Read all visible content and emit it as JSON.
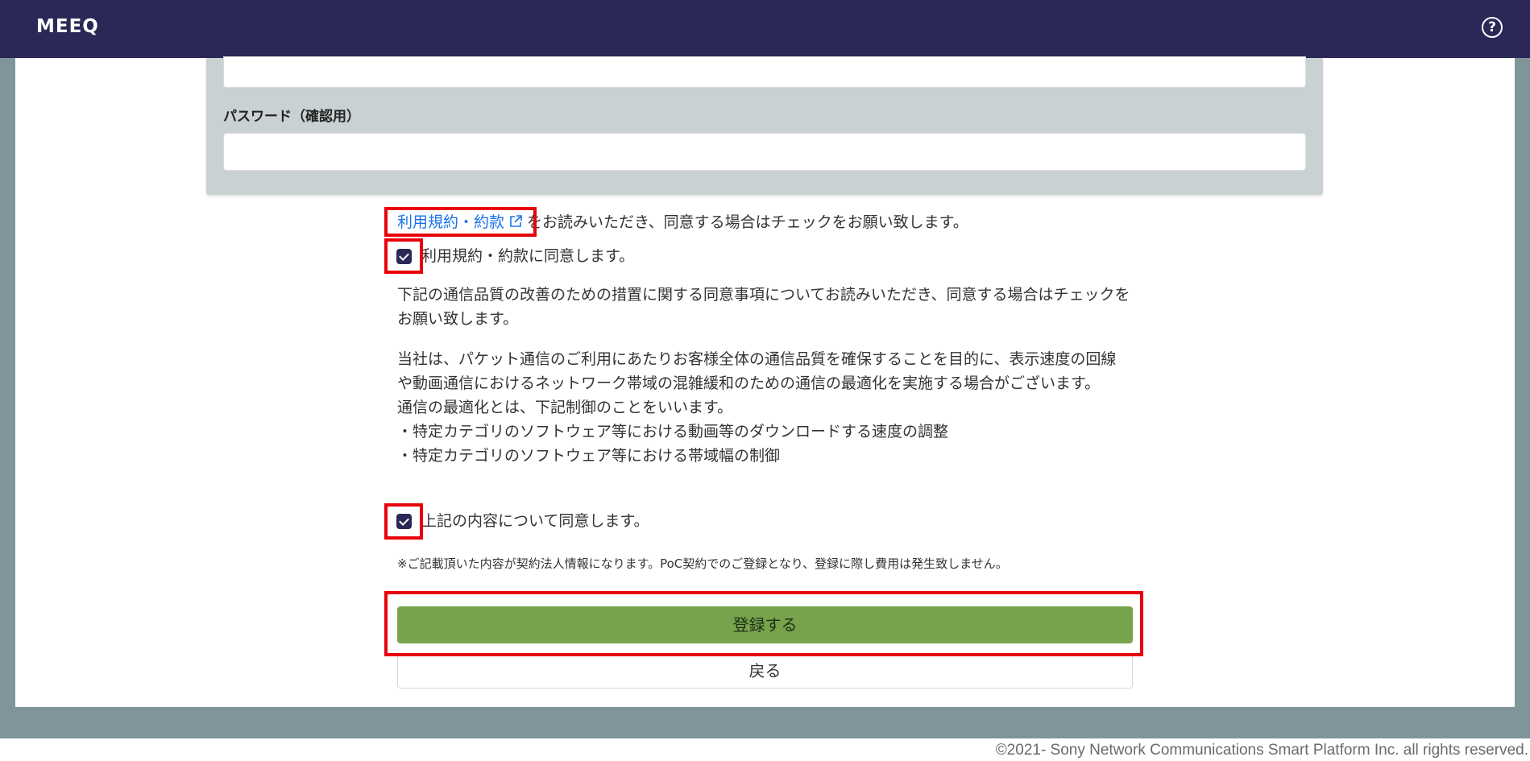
{
  "header": {
    "logo": "MEEQ",
    "help_icon": "question-circle-icon",
    "help_symbol": "?"
  },
  "form": {
    "password_confirm_label": "パスワード（確認用）",
    "password_value": "",
    "password_confirm_value": ""
  },
  "terms": {
    "link_text": "利用規約・約款",
    "link_icon": "external-link-icon",
    "instruction": "をお読みいただき、同意する場合はチェックをお願い致します。",
    "agree_label": "利用規約・約款に同意します。",
    "agree_checked": true
  },
  "quality": {
    "intro": "下記の通信品質の改善のための措置に関する同意事項についてお読みいただき、同意する場合はチェックをお願い致します。",
    "body_line1": "当社は、パケット通信のご利用にあたりお客様全体の通信品質を確保することを目的に、表示速度の回線や動画通信におけるネットワーク帯域の混雑緩和のための通信の最適化を実施する場合がございます。",
    "body_line2": "通信の最適化とは、下記制御のことをいいます。",
    "body_line3": "・特定カテゴリのソフトウェア等における動画等のダウンロードする速度の調整",
    "body_line4": "・特定カテゴリのソフトウェア等における帯域幅の制御",
    "agree_label": "上記の内容について同意します。",
    "agree_checked": true
  },
  "note": "※ご記載頂いた内容が契約法人情報になります。PoC契約でのご登録となり、登録に際し費用は発生致しません。",
  "buttons": {
    "register": "登録する",
    "back": "戻る"
  },
  "colors": {
    "header_bg": "#2a2856",
    "register_bg": "#76a34b",
    "link": "#1a73e8",
    "highlight": "#e8000b"
  },
  "footer": {
    "copyright": "©2021- Sony Network Communications Smart Platform Inc. all rights reserved."
  }
}
